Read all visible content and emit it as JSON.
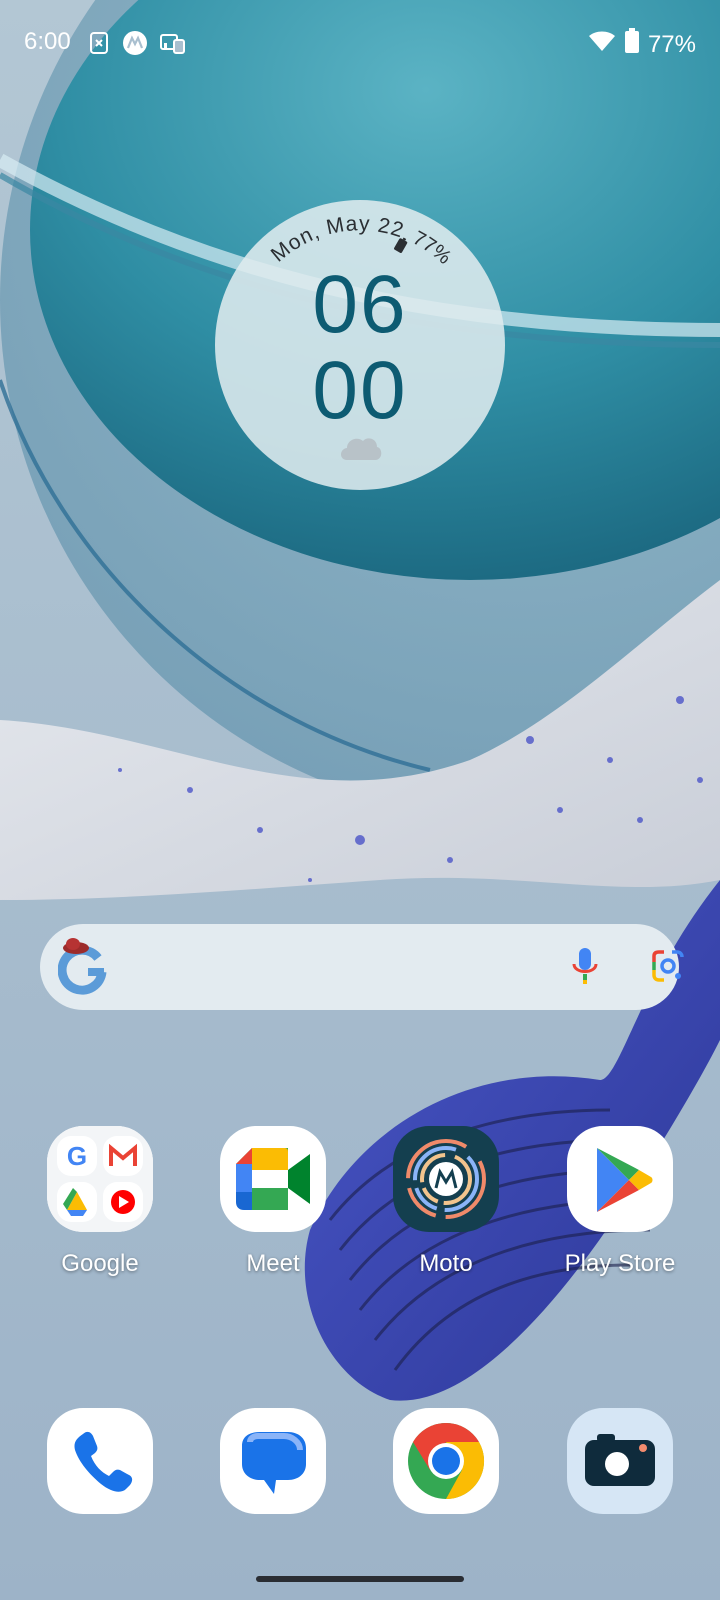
{
  "status_bar": {
    "time": "6:00",
    "battery": "77%",
    "icons": [
      "screenshot-dismiss-icon",
      "motorola-icon",
      "connected-devices-icon",
      "wifi-icon",
      "battery-icon"
    ]
  },
  "clock_widget": {
    "date": "Mon, May 22",
    "battery": "77%",
    "hours": "06",
    "minutes": "00",
    "weather_icon": "cloud-icon"
  },
  "search_bar": {
    "logo": "google-g-icon",
    "mic_icon": "mic-icon",
    "lens_icon": "google-lens-icon"
  },
  "home_apps": [
    {
      "label": "Google"
    },
    {
      "label": "Meet"
    },
    {
      "label": "Moto"
    },
    {
      "label": "Play Store"
    }
  ],
  "dock_apps": [
    {
      "name": "phone-app",
      "icon": "phone-icon"
    },
    {
      "name": "messages-app",
      "icon": "messages-icon"
    },
    {
      "name": "chrome-app",
      "icon": "chrome-icon"
    },
    {
      "name": "camera-app",
      "icon": "camera-icon"
    }
  ],
  "colors": {
    "accent": "#0d5b72",
    "wallpaper_base": "#a9bfcf"
  }
}
